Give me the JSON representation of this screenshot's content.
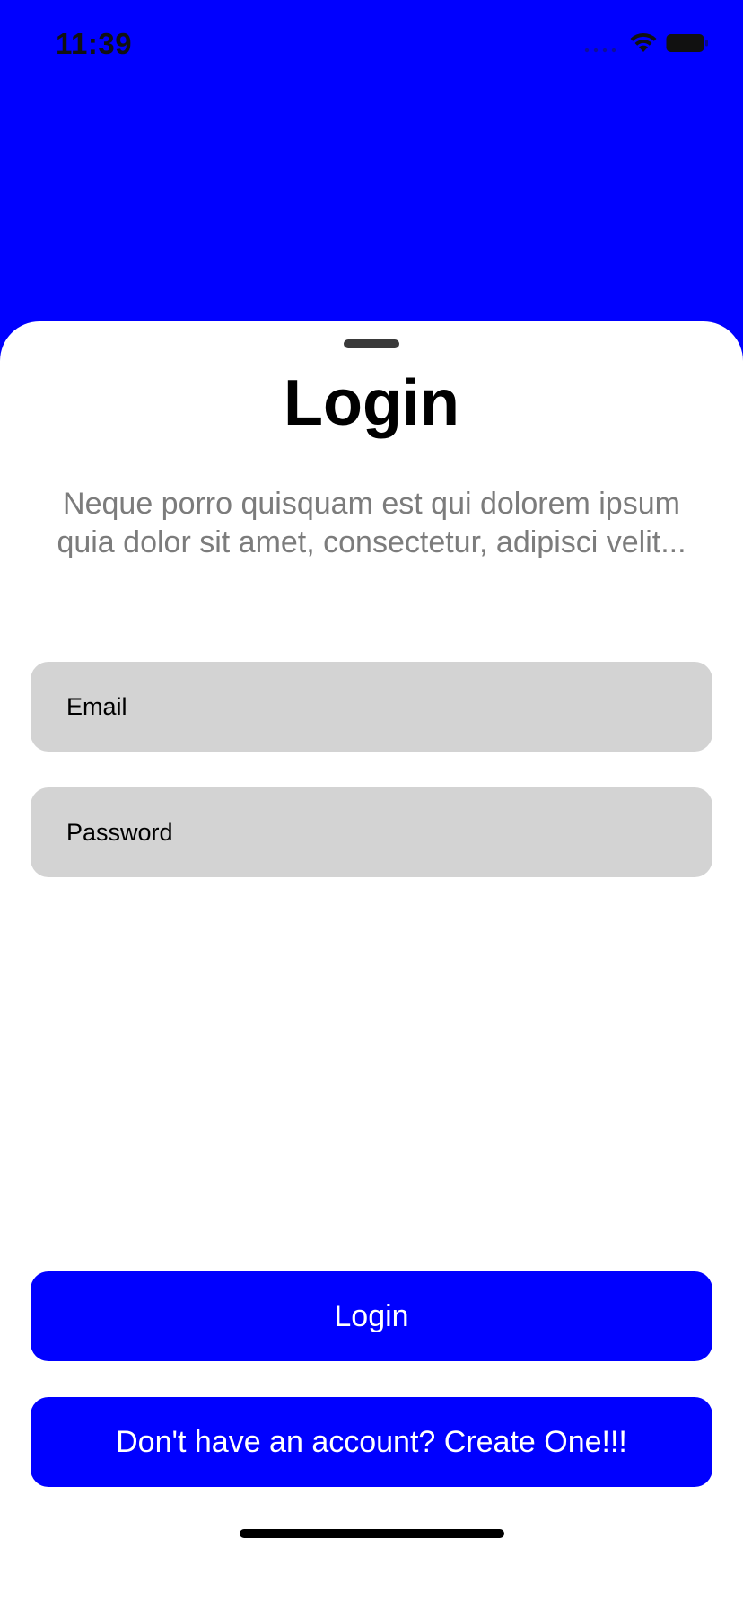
{
  "status_bar": {
    "time": "11:39",
    "icons": [
      "cellular-signal-icon",
      "wifi-icon",
      "battery-icon"
    ]
  },
  "colors": {
    "accent": "#0000ff",
    "sheet_background": "#ffffff",
    "field_background": "#d3d3d3",
    "subtitle_text": "#7c7c7c"
  },
  "sheet": {
    "title": "Login",
    "subtitle": "Neque porro quisquam est qui dolorem ipsum quia dolor sit amet, consectetur, adipisci velit...",
    "email": {
      "value": "",
      "placeholder": "Email"
    },
    "password": {
      "value": "",
      "placeholder": "Password"
    },
    "login_button_label": "Login",
    "create_account_label": "Don't have an account? Create One!!!"
  }
}
